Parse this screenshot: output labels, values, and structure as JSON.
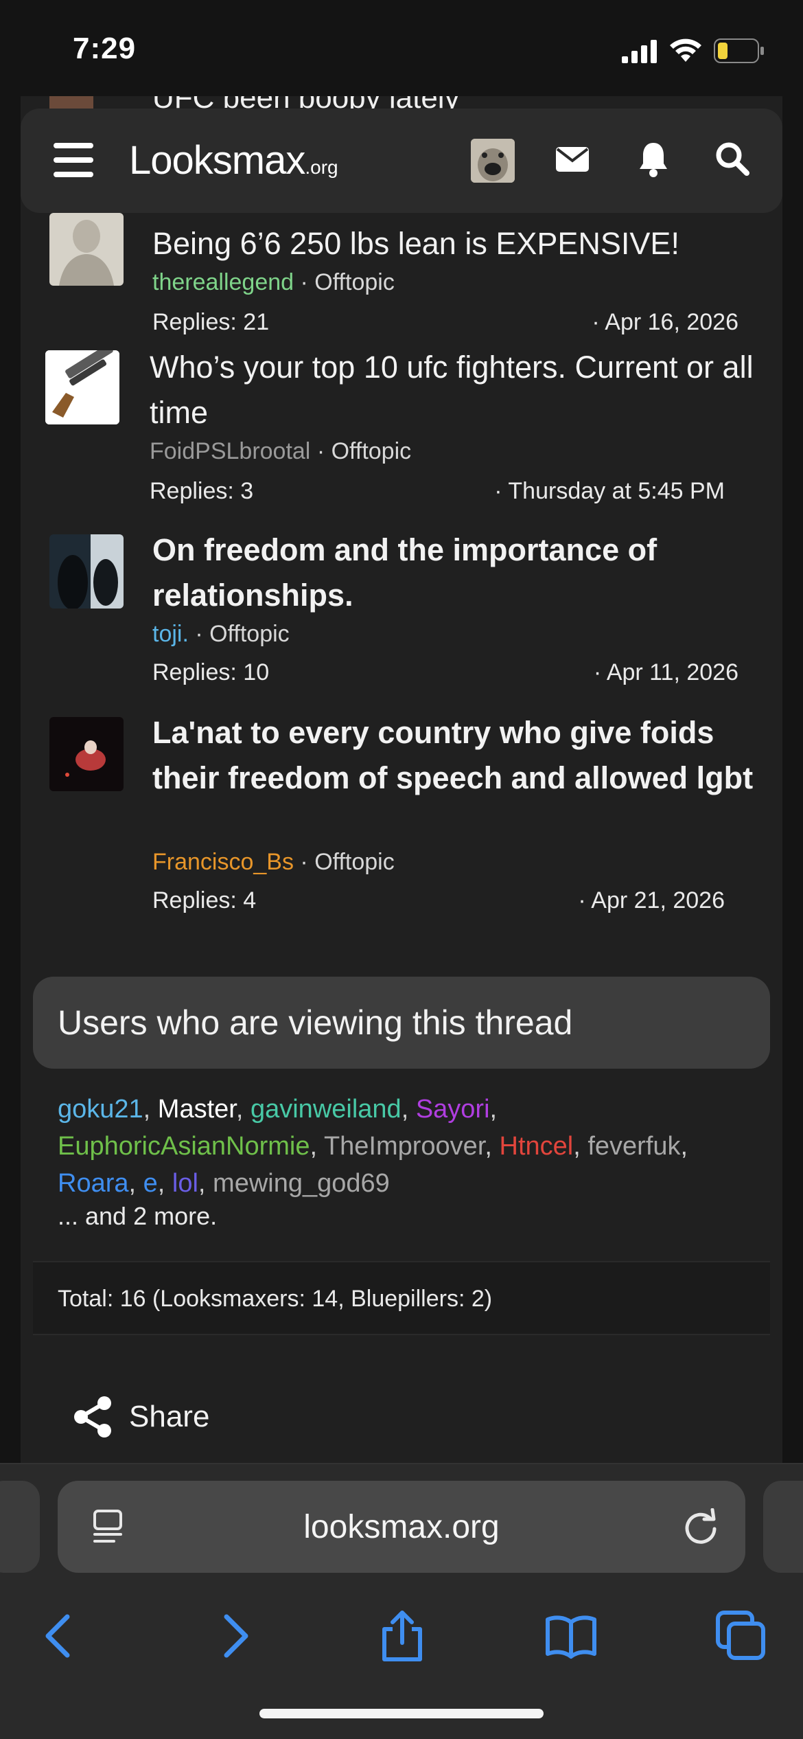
{
  "status_bar": {
    "time": "7:29"
  },
  "partial_row": {
    "title": "UFC been boopy lately"
  },
  "header": {
    "logo_main": "Looksmax",
    "logo_suffix": ".org"
  },
  "threads": [
    {
      "title": "Being 6’6 250 lbs lean is EXPENSIVE!",
      "author": "thereallegend",
      "author_color": "#7fd48a",
      "forum": "Offtopic",
      "replies": "Replies: 21",
      "date": "· Apr 16, 2026",
      "bold": false
    },
    {
      "title": "Who’s your top 10 ufc fighters. Current or all time",
      "author": "FoidPSLbrootal",
      "author_color": "#9a9a9a",
      "forum": "Offtopic",
      "replies": "Replies: 3",
      "date": "· Thursday at 5:45 PM",
      "bold": false
    },
    {
      "title": "On freedom and the importance of relationships.",
      "author": "toji.",
      "author_color": "#5bb6e8",
      "forum": "Offtopic",
      "replies": "Replies: 10",
      "date": "· Apr 11, 2026",
      "bold": true
    },
    {
      "title": "La'nat to every country who give foids their freedom of speech and allowed lgbt",
      "author": "Francisco_Bs",
      "author_color": "#e8962a",
      "forum": "Offtopic",
      "replies": "Replies: 4",
      "date": "· Apr 21, 2026",
      "bold": true
    }
  ],
  "viewers": {
    "title": "Users who are viewing this thread",
    "users": [
      {
        "name": "goku21",
        "color": "#5bb6e8"
      },
      {
        "name": "Master",
        "color": "#ffffff"
      },
      {
        "name": "gavinweiland",
        "color": "#48c9a6"
      },
      {
        "name": "Sayori",
        "color": "#b03ee0"
      },
      {
        "name": "EuphoricAsianNormie",
        "color": "#6fc04a"
      },
      {
        "name": "TheImproover",
        "color": "#a8a8a8"
      },
      {
        "name": "Htncel",
        "color": "#e2453c"
      },
      {
        "name": "feverfuk",
        "color": "#a8a8a8"
      },
      {
        "name": "Roara",
        "color": "#3f8ef0"
      },
      {
        "name": "e",
        "color": "#3f8ef0"
      },
      {
        "name": "lol",
        "color": "#6a5ee6"
      },
      {
        "name": "mewing_god69",
        "color": "#a8a8a8"
      }
    ],
    "more": "... and 2 more.",
    "total": "Total: 16 (Looksmaxers: 14, Bluepillers: 2)"
  },
  "share": {
    "label": "Share"
  },
  "browser": {
    "url": "looksmax.org"
  },
  "icons": {
    "menu": "menu-icon",
    "mail": "mail-icon",
    "bell": "bell-icon",
    "search": "search-icon",
    "share": "share-icon",
    "reader": "reader-icon",
    "reload": "reload-icon",
    "back": "back-icon",
    "forward": "forward-icon",
    "share_sheet": "share-sheet-icon",
    "bookmarks": "bookmarks-icon",
    "tabs": "tabs-icon"
  },
  "colors": {
    "accent_blue": "#3f8ef0",
    "panel": "#202020",
    "header": "#2b2b2b"
  }
}
